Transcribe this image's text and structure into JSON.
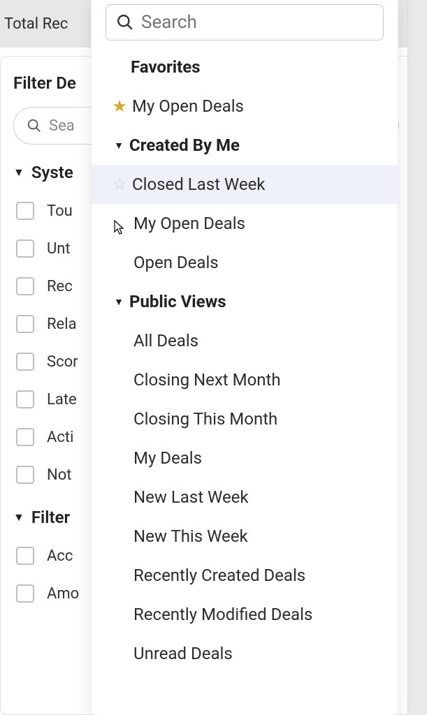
{
  "header": {
    "total_label": "Total Rec"
  },
  "filter_panel": {
    "title": "Filter De",
    "search_placeholder": "Sea",
    "sections": [
      {
        "name": "Syste",
        "items": [
          "Tou",
          "Unt",
          "Rec",
          "Rela",
          "Scor",
          "Late",
          "Acti",
          "Not"
        ]
      },
      {
        "name": "Filter",
        "items": [
          "Acc",
          "Amo"
        ]
      }
    ]
  },
  "dropdown": {
    "search_placeholder": "Search",
    "favorites_label": "Favorites",
    "favorites": [
      {
        "label": "My Open Deals",
        "starred": true
      }
    ],
    "created_by_me_label": "Created By Me",
    "created_by_me": [
      {
        "label": "Closed Last Week",
        "hover": true
      },
      {
        "label": "My Open Deals"
      },
      {
        "label": "Open Deals"
      }
    ],
    "public_views_label": "Public Views",
    "public_views": [
      {
        "label": "All Deals"
      },
      {
        "label": "Closing Next Month"
      },
      {
        "label": "Closing This Month"
      },
      {
        "label": "My Deals"
      },
      {
        "label": "New Last Week"
      },
      {
        "label": "New This Week"
      },
      {
        "label": "Recently Created Deals"
      },
      {
        "label": "Recently Modified Deals"
      },
      {
        "label": "Unread Deals"
      }
    ]
  }
}
